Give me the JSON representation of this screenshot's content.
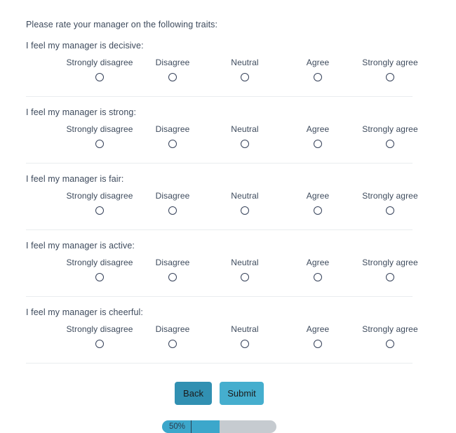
{
  "survey": {
    "intro": "Please rate your manager on the following traits:",
    "scale_options": [
      "Strongly disagree",
      "Disagree",
      "Neutral",
      "Agree",
      "Strongly agree"
    ],
    "questions": [
      {
        "text": "I feel my manager is decisive:"
      },
      {
        "text": "I feel my manager is strong:"
      },
      {
        "text": "I feel my manager is fair:"
      },
      {
        "text": "I feel my manager is active:"
      },
      {
        "text": "I feel my manager is cheerful:"
      }
    ]
  },
  "actions": {
    "back_label": "Back",
    "submit_label": "Submit"
  },
  "progress": {
    "label": "50%",
    "percent": 50
  },
  "colors": {
    "back_button": "#3190b2",
    "submit_button": "#45aece",
    "progress_fill": "#3ca7cb",
    "progress_track": "#c6cbd0",
    "text": "#3d4a5c",
    "divider": "#e9ecef"
  }
}
